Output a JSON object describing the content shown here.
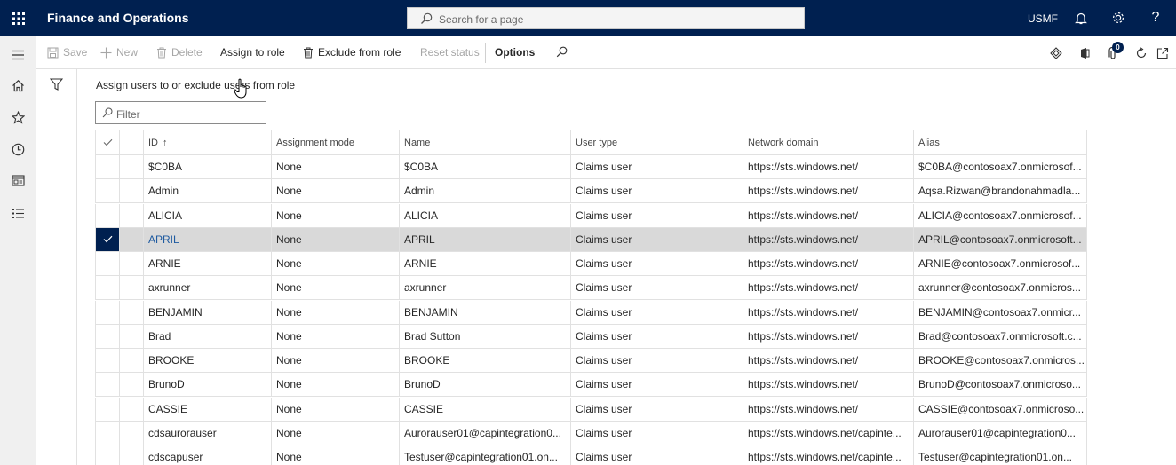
{
  "app": {
    "title": "Finance and Operations",
    "search_placeholder": "Search for a page",
    "company": "USMF",
    "help_glyph": "?",
    "brand_color": "#002050"
  },
  "actions": {
    "save": "Save",
    "new": "New",
    "delete": "Delete",
    "assign_to_role": "Assign to role",
    "exclude_from_role": "Exclude from role",
    "reset_status": "Reset status",
    "options": "Options",
    "notifications_count": "0"
  },
  "page": {
    "title": "Assign users to or exclude users from role",
    "filter_placeholder": "Filter"
  },
  "grid": {
    "columns": [
      "ID",
      "Assignment mode",
      "Name",
      "User type",
      "Network domain",
      "Alias"
    ],
    "sort_indicator": "↑",
    "selected_row_index": 3,
    "rows": [
      {
        "id": "$C0BA",
        "mode": "None",
        "name": "$C0BA",
        "type": "Claims user",
        "domain": "https://sts.windows.net/",
        "alias": "$C0BA@contosoax7.onmicrosof..."
      },
      {
        "id": "Admin",
        "mode": "None",
        "name": "Admin",
        "type": "Claims user",
        "domain": "https://sts.windows.net/",
        "alias": "Aqsa.Rizwan@brandonahmadla..."
      },
      {
        "id": "ALICIA",
        "mode": "None",
        "name": "ALICIA",
        "type": "Claims user",
        "domain": "https://sts.windows.net/",
        "alias": "ALICIA@contosoax7.onmicrosof..."
      },
      {
        "id": "APRIL",
        "mode": "None",
        "name": "APRIL",
        "type": "Claims user",
        "domain": "https://sts.windows.net/",
        "alias": "APRIL@contosoax7.onmicrosoft..."
      },
      {
        "id": "ARNIE",
        "mode": "None",
        "name": "ARNIE",
        "type": "Claims user",
        "domain": "https://sts.windows.net/",
        "alias": "ARNIE@contosoax7.onmicrosof..."
      },
      {
        "id": "axrunner",
        "mode": "None",
        "name": "axrunner",
        "type": "Claims user",
        "domain": "https://sts.windows.net/",
        "alias": "axrunner@contosoax7.onmicros..."
      },
      {
        "id": "BENJAMIN",
        "mode": "None",
        "name": "BENJAMIN",
        "type": "Claims user",
        "domain": "https://sts.windows.net/",
        "alias": "BENJAMIN@contosoax7.onmicr..."
      },
      {
        "id": "Brad",
        "mode": "None",
        "name": "Brad Sutton",
        "type": "Claims user",
        "domain": "https://sts.windows.net/",
        "alias": "Brad@contosoax7.onmicrosoft.c..."
      },
      {
        "id": "BROOKE",
        "mode": "None",
        "name": "BROOKE",
        "type": "Claims user",
        "domain": "https://sts.windows.net/",
        "alias": "BROOKE@contosoax7.onmicros..."
      },
      {
        "id": "BrunoD",
        "mode": "None",
        "name": "BrunoD",
        "type": "Claims user",
        "domain": "https://sts.windows.net/",
        "alias": "BrunoD@contosoax7.onmicroso..."
      },
      {
        "id": "CASSIE",
        "mode": "None",
        "name": "CASSIE",
        "type": "Claims user",
        "domain": "https://sts.windows.net/",
        "alias": "CASSIE@contosoax7.onmicroso..."
      },
      {
        "id": "cdsaurorauser",
        "mode": "None",
        "name": "Aurorauser01@capintegration0...",
        "type": "Claims user",
        "domain": "https://sts.windows.net/capinte...",
        "alias": "Aurorauser01@capintegration0..."
      },
      {
        "id": "cdscapuser",
        "mode": "None",
        "name": "Testuser@capintegration01.on...",
        "type": "Claims user",
        "domain": "https://sts.windows.net/capinte...",
        "alias": "Testuser@capintegration01.on..."
      }
    ]
  }
}
